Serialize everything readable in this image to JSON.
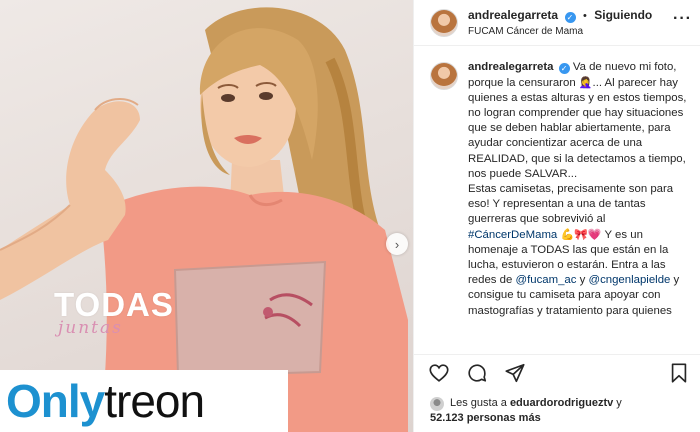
{
  "post": {
    "username": "andrealegarreta",
    "dot": "•",
    "follow_status": "Siguiendo",
    "location": "FUCAM Cáncer de Mama",
    "more_label": "···"
  },
  "photo": {
    "overlay_title": "TODAS",
    "overlay_subtitle": "juntas",
    "next_label": "›"
  },
  "watermark": {
    "part1": "Only",
    "part2": "treon"
  },
  "caption": {
    "username": "andrealegarreta",
    "p1": "Va de nuevo mi foto, porque la censuraron",
    "e1": "🤦‍♀️",
    "p2": "... Al parecer hay quienes a estas alturas y en estos tiempos, no logran comprender que hay situaciones que se deben hablar abiertamente, para ayudar concientizar acerca de una REALIDAD, que si la detectamos a tiempo, nos puede SALVAR...",
    "p3": "Estas camisetas, precisamente son para eso! Y representan a una de tantas guerreras que sobrevivió al",
    "hashtag": "#CáncerDeMama",
    "e2": "💪🎀💗",
    "p4": "Y es un homenaje a TODAS las que están en la lucha, estuvieron o estarán. Entra a las redes de",
    "mention1": "@fucam_ac",
    "and": "y",
    "mention2": "@cngenlapielde",
    "p5": "y consigue tu camiseta para apoyar con mastografías y tratamiento para quienes"
  },
  "likes": {
    "prefix": "Les gusta a",
    "user": "eduardorodrigueztv",
    "joiner": "y",
    "count": "52.123 personas más"
  },
  "icons": [
    "heart-icon",
    "comment-icon",
    "share-icon",
    "bookmark-icon",
    "verified-icon",
    "chevron-right-icon"
  ],
  "colors": {
    "accent": "#3897f0",
    "link": "#00376b",
    "watermark_blue": "#1d91d0"
  }
}
